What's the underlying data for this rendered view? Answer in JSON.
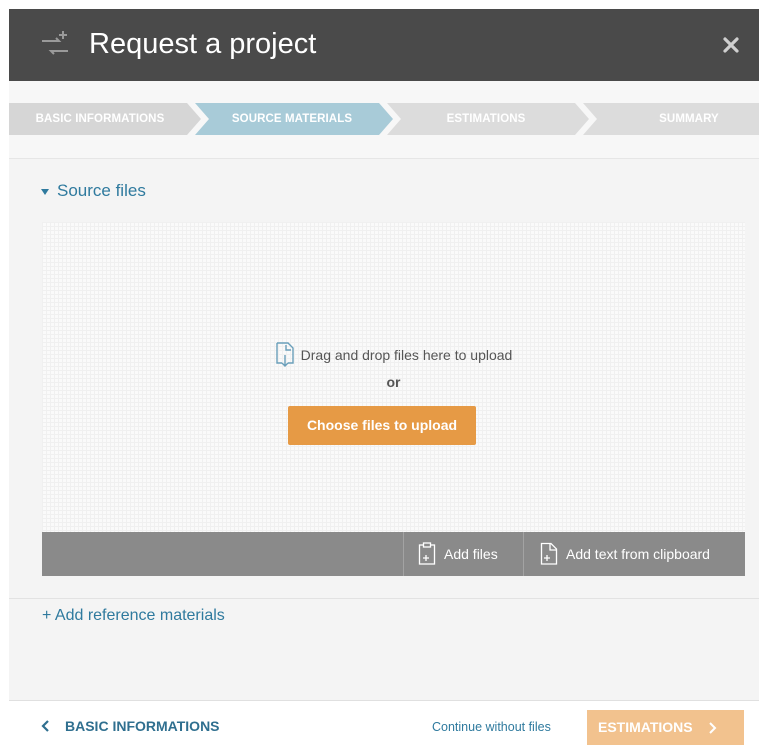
{
  "window": {
    "title": "Request a project",
    "title_icon": "project-add-icon",
    "close_icon": "close-icon"
  },
  "steps": [
    {
      "label": "BASIC INFORMATIONS",
      "state": "done"
    },
    {
      "label": "SOURCE MATERIALS",
      "state": "active"
    },
    {
      "label": "ESTIMATIONS",
      "state": "upcoming"
    },
    {
      "label": "SUMMARY",
      "state": "upcoming"
    }
  ],
  "colors": {
    "header_bg": "#4a4a4a",
    "step_done": "#d6d6d6",
    "step_active": "#a8cbd8",
    "step_upcoming": "#dcdcdc",
    "link": "#2f7a9e",
    "primary_button": "#e69a45",
    "next_button_disabled": "#f2c28e",
    "toolbar_bg": "#8a8a8a"
  },
  "source_files": {
    "section_label": "Source files",
    "toggle_icon": "caret-down-icon",
    "drop_hint": "Drag and drop files here to upload",
    "drop_icon": "file-download-icon",
    "or_text": "or",
    "choose_button": "Choose files to upload",
    "toolbar": {
      "add_files": "Add files",
      "add_files_icon": "clipboard-add-icon",
      "add_clipboard": "Add text from clipboard",
      "add_clipboard_icon": "file-add-icon"
    }
  },
  "reference": {
    "add_label": "+ Add reference materials"
  },
  "footer": {
    "back_label": "BASIC INFORMATIONS",
    "back_icon": "chevron-left-icon",
    "continue_label": "Continue without files",
    "next_label": "ESTIMATIONS",
    "next_icon": "chevron-right-icon"
  }
}
